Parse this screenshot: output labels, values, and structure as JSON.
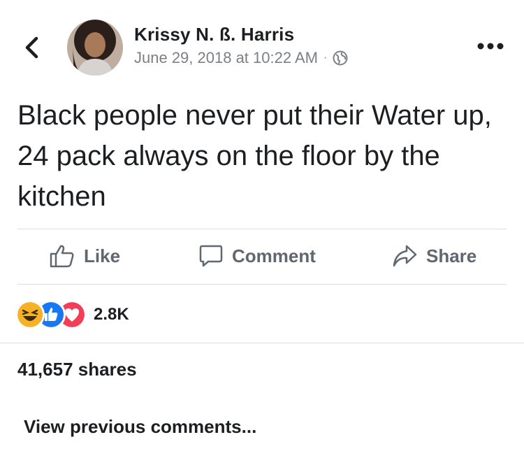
{
  "post": {
    "author": "Krissy N. ß. Harris",
    "timestamp": "June 29, 2018 at 10:22 AM",
    "separator": "·",
    "privacy_icon": "globe-icon",
    "text": "Black people never put their Water up, 24 pack always on the floor by the kitchen"
  },
  "actions": {
    "like": "Like",
    "comment": "Comment",
    "share": "Share"
  },
  "reactions": {
    "icons": [
      "haha-icon",
      "like-reaction-icon",
      "love-reaction-icon"
    ],
    "count": "2.8K"
  },
  "shares": "41,657 shares",
  "comments": {
    "view_previous": "View previous comments..."
  },
  "colors": {
    "like_blue": "#1877f2",
    "love_red": "#f33e58",
    "haha_yellow": "#f7b125",
    "muted_text": "#606770"
  }
}
